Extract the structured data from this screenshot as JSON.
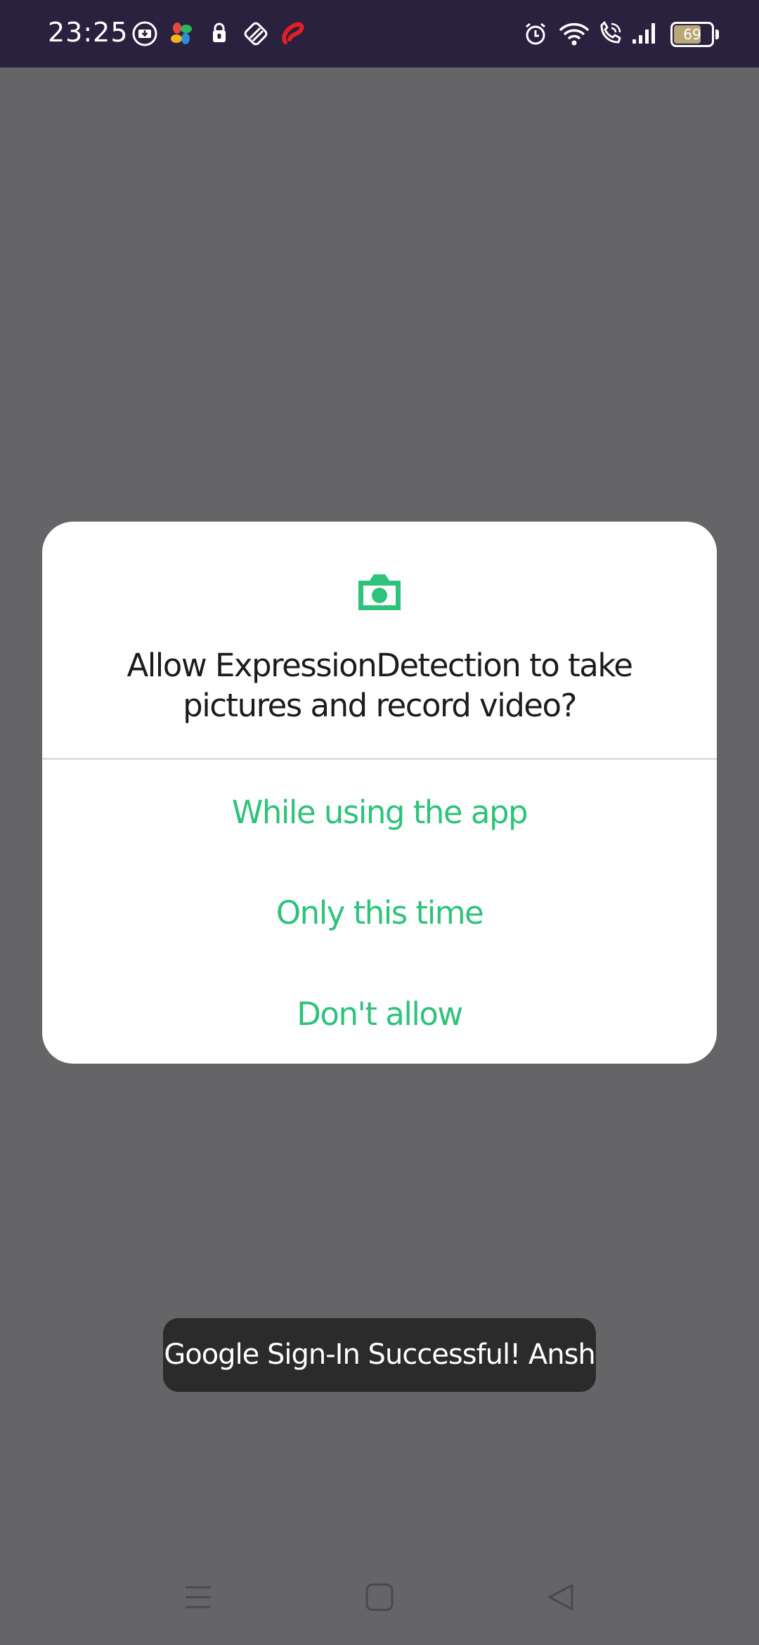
{
  "status_bar": {
    "time": "23:25",
    "battery_level": "69",
    "left_icons": [
      "download-icon",
      "app-pinwheel-icon",
      "lock-bag-icon",
      "shield-app-icon",
      "airtel-icon"
    ],
    "right_icons": [
      "alarm-icon",
      "wifi-icon",
      "wifi-call-icon",
      "signal-icon",
      "battery-icon"
    ]
  },
  "dialog": {
    "icon": "camera-icon",
    "title": "Allow ExpressionDetection to take pictures and record video?",
    "options": [
      {
        "label": "While using the app"
      },
      {
        "label": "Only this time"
      },
      {
        "label": "Don't allow"
      }
    ],
    "accent_color": "#2fc27b"
  },
  "toast": {
    "message": "Google Sign-In Successful! Ansh"
  },
  "nav_bar": {
    "buttons": [
      "menu-icon",
      "home-icon",
      "back-icon"
    ]
  }
}
